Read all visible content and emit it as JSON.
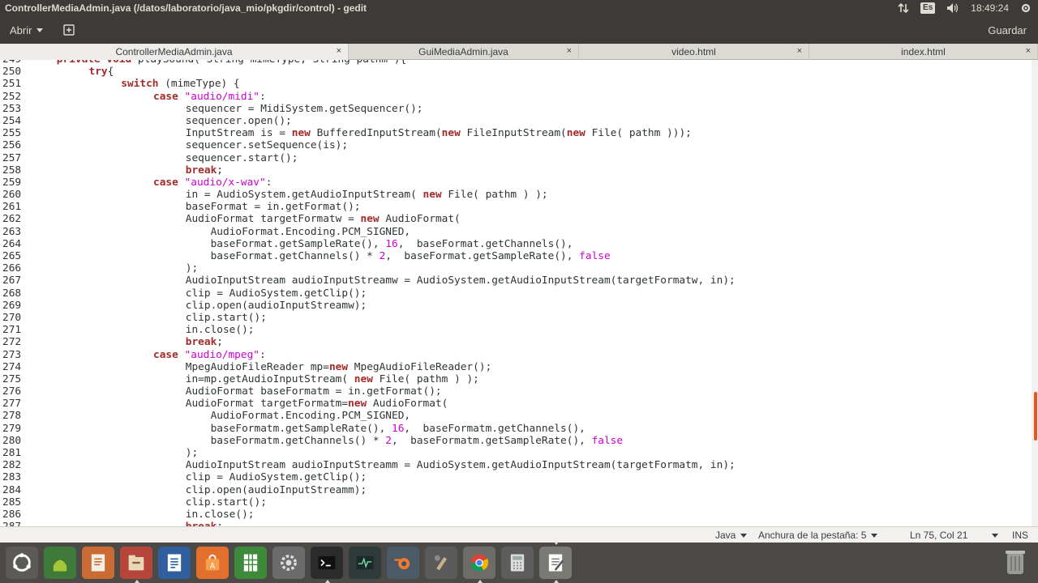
{
  "window": {
    "title": "ControllerMediaAdmin.java (/datos/laboratorio/java_mio/pkgdir/control) - gedit"
  },
  "panel": {
    "keyboard_layout": "Es",
    "clock": "18:49:24"
  },
  "toolbar": {
    "open_label": "Abrir",
    "save_label": "Guardar"
  },
  "tabs": [
    {
      "label": "ControllerMediaAdmin.java",
      "active": true
    },
    {
      "label": "GuiMediaAdmin.java",
      "active": false
    },
    {
      "label": "video.html",
      "active": false
    },
    {
      "label": "index.html",
      "active": false
    }
  ],
  "tab_close_glyph": "×",
  "editor": {
    "lines": [
      {
        "n": "249",
        "indent": 1,
        "parts": [
          [
            "kw",
            "private void"
          ],
          [
            "t",
            " playSound( String mimeType, String pathm ){"
          ]
        ]
      },
      {
        "n": "250",
        "indent": 2,
        "parts": [
          [
            "kw",
            "try"
          ],
          [
            "t",
            "{"
          ]
        ]
      },
      {
        "n": "251",
        "indent": 3,
        "parts": [
          [
            "kw",
            "switch"
          ],
          [
            "t",
            " (mimeType) {"
          ]
        ]
      },
      {
        "n": "252",
        "indent": 4,
        "parts": [
          [
            "kw",
            "case"
          ],
          [
            "t",
            " "
          ],
          [
            "str",
            "\"audio/midi\""
          ],
          [
            "t",
            ":"
          ]
        ]
      },
      {
        "n": "253",
        "indent": 5,
        "parts": [
          [
            "t",
            "sequencer = MidiSystem.getSequencer();"
          ]
        ]
      },
      {
        "n": "254",
        "indent": 5,
        "parts": [
          [
            "t",
            "sequencer.open();"
          ]
        ]
      },
      {
        "n": "255",
        "indent": 5,
        "parts": [
          [
            "t",
            "InputStream is = "
          ],
          [
            "kw",
            "new"
          ],
          [
            "t",
            " BufferedInputStream("
          ],
          [
            "kw",
            "new"
          ],
          [
            "t",
            " FileInputStream("
          ],
          [
            "kw",
            "new"
          ],
          [
            "t",
            " File( pathm )));"
          ]
        ]
      },
      {
        "n": "256",
        "indent": 5,
        "parts": [
          [
            "t",
            "sequencer.setSequence(is);"
          ]
        ]
      },
      {
        "n": "257",
        "indent": 5,
        "parts": [
          [
            "t",
            "sequencer.start();"
          ]
        ]
      },
      {
        "n": "258",
        "indent": 5,
        "parts": [
          [
            "kw",
            "break"
          ],
          [
            "t",
            ";"
          ]
        ]
      },
      {
        "n": "259",
        "indent": 4,
        "parts": [
          [
            "kw",
            "case"
          ],
          [
            "t",
            " "
          ],
          [
            "str",
            "\"audio/x-wav\""
          ],
          [
            "t",
            ":"
          ]
        ]
      },
      {
        "n": "260",
        "indent": 5,
        "parts": [
          [
            "t",
            "in = AudioSystem.getAudioInputStream( "
          ],
          [
            "kw",
            "new"
          ],
          [
            "t",
            " File( pathm ) );"
          ]
        ]
      },
      {
        "n": "261",
        "indent": 5,
        "parts": [
          [
            "t",
            "baseFormat = in.getFormat();"
          ]
        ]
      },
      {
        "n": "262",
        "indent": 5,
        "parts": [
          [
            "t",
            "AudioFormat targetFormatw = "
          ],
          [
            "kw",
            "new"
          ],
          [
            "t",
            " AudioFormat("
          ]
        ]
      },
      {
        "n": "263",
        "indent": 5,
        "parts": [
          [
            "t",
            "    AudioFormat.Encoding.PCM_SIGNED,"
          ]
        ]
      },
      {
        "n": "264",
        "indent": 5,
        "parts": [
          [
            "t",
            "    baseFormat.getSampleRate(), "
          ],
          [
            "lit",
            "16"
          ],
          [
            "t",
            ",  baseFormat.getChannels(),"
          ]
        ]
      },
      {
        "n": "265",
        "indent": 5,
        "parts": [
          [
            "t",
            "    baseFormat.getChannels() * "
          ],
          [
            "lit",
            "2"
          ],
          [
            "t",
            ",  baseFormat.getSampleRate(), "
          ],
          [
            "lit",
            "false"
          ]
        ]
      },
      {
        "n": "266",
        "indent": 5,
        "parts": [
          [
            "t",
            ");"
          ]
        ]
      },
      {
        "n": "267",
        "indent": 5,
        "parts": [
          [
            "t",
            "AudioInputStream audioInputStreamw = AudioSystem.getAudioInputStream(targetFormatw, in);"
          ]
        ]
      },
      {
        "n": "268",
        "indent": 5,
        "parts": [
          [
            "t",
            "clip = AudioSystem.getClip();"
          ]
        ]
      },
      {
        "n": "269",
        "indent": 5,
        "parts": [
          [
            "t",
            "clip.open(audioInputStreamw);"
          ]
        ]
      },
      {
        "n": "270",
        "indent": 5,
        "parts": [
          [
            "t",
            "clip.start();"
          ]
        ]
      },
      {
        "n": "271",
        "indent": 5,
        "parts": [
          [
            "t",
            "in.close();"
          ]
        ]
      },
      {
        "n": "272",
        "indent": 5,
        "parts": [
          [
            "kw",
            "break"
          ],
          [
            "t",
            ";"
          ]
        ]
      },
      {
        "n": "273",
        "indent": 4,
        "parts": [
          [
            "kw",
            "case"
          ],
          [
            "t",
            " "
          ],
          [
            "str",
            "\"audio/mpeg\""
          ],
          [
            "t",
            ":"
          ]
        ]
      },
      {
        "n": "274",
        "indent": 5,
        "parts": [
          [
            "t",
            "MpegAudioFileReader mp="
          ],
          [
            "kw",
            "new"
          ],
          [
            "t",
            " MpegAudioFileReader();"
          ]
        ]
      },
      {
        "n": "275",
        "indent": 5,
        "parts": [
          [
            "t",
            "in=mp.getAudioInputStream( "
          ],
          [
            "kw",
            "new"
          ],
          [
            "t",
            " File( pathm ) );"
          ]
        ]
      },
      {
        "n": "276",
        "indent": 5,
        "parts": [
          [
            "t",
            "AudioFormat baseFormatm = in.getFormat();"
          ]
        ]
      },
      {
        "n": "277",
        "indent": 5,
        "parts": [
          [
            "t",
            "AudioFormat targetFormatm="
          ],
          [
            "kw",
            "new"
          ],
          [
            "t",
            " AudioFormat("
          ]
        ]
      },
      {
        "n": "278",
        "indent": 5,
        "parts": [
          [
            "t",
            "    AudioFormat.Encoding.PCM_SIGNED,"
          ]
        ]
      },
      {
        "n": "279",
        "indent": 5,
        "parts": [
          [
            "t",
            "    baseFormatm.getSampleRate(), "
          ],
          [
            "lit",
            "16"
          ],
          [
            "t",
            ",  baseFormatm.getChannels(),"
          ]
        ]
      },
      {
        "n": "280",
        "indent": 5,
        "parts": [
          [
            "t",
            "    baseFormatm.getChannels() * "
          ],
          [
            "lit",
            "2"
          ],
          [
            "t",
            ",  baseFormatm.getSampleRate(), "
          ],
          [
            "lit",
            "false"
          ]
        ]
      },
      {
        "n": "281",
        "indent": 5,
        "parts": [
          [
            "t",
            ");"
          ]
        ]
      },
      {
        "n": "282",
        "indent": 5,
        "parts": [
          [
            "t",
            "AudioInputStream audioInputStreamm = AudioSystem.getAudioInputStream(targetFormatm, in);"
          ]
        ]
      },
      {
        "n": "283",
        "indent": 5,
        "parts": [
          [
            "t",
            "clip = AudioSystem.getClip();"
          ]
        ]
      },
      {
        "n": "284",
        "indent": 5,
        "parts": [
          [
            "t",
            "clip.open(audioInputStreamm);"
          ]
        ]
      },
      {
        "n": "285",
        "indent": 5,
        "parts": [
          [
            "t",
            "clip.start();"
          ]
        ]
      },
      {
        "n": "286",
        "indent": 5,
        "parts": [
          [
            "t",
            "in.close();"
          ]
        ]
      },
      {
        "n": "287",
        "indent": 5,
        "parts": [
          [
            "kw",
            "break"
          ],
          [
            "t",
            ";"
          ]
        ]
      }
    ]
  },
  "statusbar": {
    "language": "Java",
    "tab_width": "Anchura de la pestaña: 5",
    "position": "Ln 75, Col 21",
    "mode": "INS"
  },
  "dock": {
    "apps": [
      {
        "name": "ubuntu-logo-icon",
        "bg": "#5b5a56"
      },
      {
        "name": "android-studio-icon",
        "bg": "#3f7a3a"
      },
      {
        "name": "document-viewer-icon",
        "bg": "#c96b33"
      },
      {
        "name": "files-icon",
        "bg": "#b6463c"
      },
      {
        "name": "libreoffice-writer-icon",
        "bg": "#2f5f9e"
      },
      {
        "name": "software-center-icon",
        "bg": "#e2702c"
      },
      {
        "name": "libreoffice-calc-icon",
        "bg": "#3c8a3a"
      },
      {
        "name": "system-settings-icon",
        "bg": "#6b6b6b"
      },
      {
        "name": "terminal-icon",
        "bg": "#2c2c2c"
      },
      {
        "name": "system-monitor-icon",
        "bg": "#2f3a3a"
      },
      {
        "name": "blender-icon",
        "bg": "#4a5a66"
      },
      {
        "name": "gimp-icon",
        "bg": "#5a5a5a"
      },
      {
        "name": "chrome-icon",
        "bg": "#6d6c68"
      },
      {
        "name": "calculator-icon",
        "bg": "#5d5d5d"
      },
      {
        "name": "gedit-icon",
        "bg": "#7a7973"
      }
    ],
    "active_index": 14,
    "open_indices": [
      3,
      8,
      12,
      14
    ]
  }
}
